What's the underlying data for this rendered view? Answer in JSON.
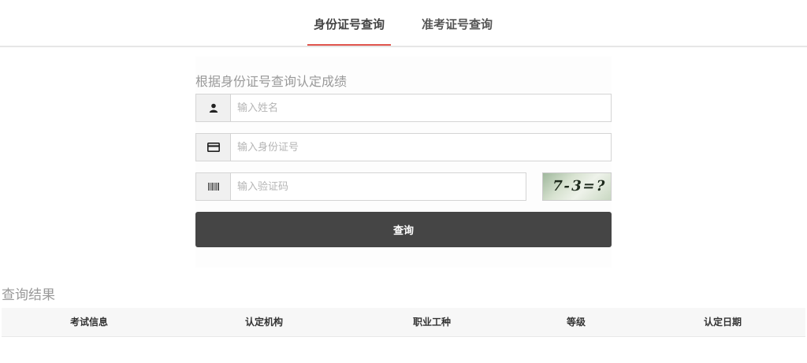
{
  "tabs": [
    {
      "label": "身份证号查询",
      "active": true
    },
    {
      "label": "准考证号查询",
      "active": false
    }
  ],
  "form": {
    "title": "根据身份证号查询认定成绩",
    "name_placeholder": "输入姓名",
    "idcard_placeholder": "输入身份证号",
    "captcha_placeholder": "输入验证码",
    "captcha_text": "7-3=?",
    "submit_label": "查询",
    "icons": {
      "name": "user-icon",
      "idcard": "id-card-icon",
      "captcha": "barcode-icon"
    }
  },
  "results": {
    "title": "查询结果",
    "columns": [
      "考试信息",
      "认定机构",
      "职业工种",
      "等级",
      "认定日期"
    ]
  },
  "colors": {
    "accent": "#e0554d",
    "button": "#454545",
    "header_bg": "#f7f7f7"
  }
}
